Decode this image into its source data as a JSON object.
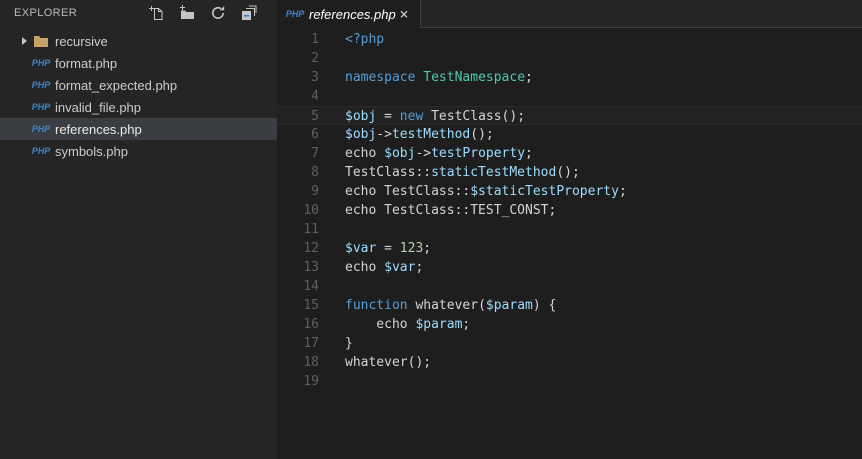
{
  "colors": {
    "editor_bg": "#1e1e1e",
    "sidebar_bg": "#252526",
    "selected_row_bg": "#3a3d41",
    "keyword": "#569cd6",
    "class_name": "#4ec9b0",
    "variable": "#9cdcfe",
    "number": "#b5cea8",
    "default_text": "#d4d4d4",
    "line_number": "#5f5f5f",
    "php_icon_blue": "#3e85c7",
    "folder_tan": "#c5a266",
    "icon_gray": "#c5c5c5"
  },
  "explorer": {
    "title": "EXPLORER",
    "actions": [
      {
        "name": "new-file-icon"
      },
      {
        "name": "new-folder-icon"
      },
      {
        "name": "refresh-icon"
      },
      {
        "name": "collapse-all-icon"
      }
    ],
    "php_badge_text": "PHP",
    "items": [
      {
        "kind": "folder",
        "label": "recursive",
        "expanded": false,
        "selected": false
      },
      {
        "kind": "php-file",
        "label": "format.php",
        "selected": false
      },
      {
        "kind": "php-file",
        "label": "format_expected.php",
        "selected": false
      },
      {
        "kind": "php-file",
        "label": "invalid_file.php",
        "selected": false
      },
      {
        "kind": "php-file",
        "label": "references.php",
        "selected": true
      },
      {
        "kind": "php-file",
        "label": "symbols.php",
        "selected": false
      }
    ]
  },
  "editor": {
    "tab": {
      "icon": "PHP",
      "label": "references.php",
      "close_label": "×"
    },
    "active_line": 5,
    "lines": [
      {
        "num": 1,
        "tokens": [
          [
            "kw",
            "<?php"
          ]
        ]
      },
      {
        "num": 2,
        "tokens": []
      },
      {
        "num": 3,
        "tokens": [
          [
            "kw",
            "namespace"
          ],
          [
            "def",
            " "
          ],
          [
            "cls",
            "TestNamespace"
          ],
          [
            "def",
            ";"
          ]
        ]
      },
      {
        "num": 4,
        "tokens": []
      },
      {
        "num": 5,
        "tokens": [
          [
            "var",
            "$obj"
          ],
          [
            "def",
            " = "
          ],
          [
            "kw",
            "new"
          ],
          [
            "def",
            " TestClass();"
          ]
        ]
      },
      {
        "num": 6,
        "tokens": [
          [
            "var",
            "$obj"
          ],
          [
            "def",
            "->"
          ],
          [
            "var",
            "testMethod"
          ],
          [
            "def",
            "();"
          ]
        ]
      },
      {
        "num": 7,
        "tokens": [
          [
            "def",
            "echo "
          ],
          [
            "var",
            "$obj"
          ],
          [
            "def",
            "->"
          ],
          [
            "var",
            "testProperty"
          ],
          [
            "def",
            ";"
          ]
        ]
      },
      {
        "num": 8,
        "tokens": [
          [
            "def",
            "TestClass::"
          ],
          [
            "var",
            "staticTestMethod"
          ],
          [
            "def",
            "();"
          ]
        ]
      },
      {
        "num": 9,
        "tokens": [
          [
            "def",
            "echo TestClass::"
          ],
          [
            "var",
            "$staticTestProperty"
          ],
          [
            "def",
            ";"
          ]
        ]
      },
      {
        "num": 10,
        "tokens": [
          [
            "def",
            "echo TestClass::TEST_CONST;"
          ]
        ]
      },
      {
        "num": 11,
        "tokens": []
      },
      {
        "num": 12,
        "tokens": [
          [
            "var",
            "$var"
          ],
          [
            "def",
            " = "
          ],
          [
            "num",
            "123"
          ],
          [
            "def",
            ";"
          ]
        ]
      },
      {
        "num": 13,
        "tokens": [
          [
            "def",
            "echo "
          ],
          [
            "var",
            "$var"
          ],
          [
            "def",
            ";"
          ]
        ]
      },
      {
        "num": 14,
        "tokens": []
      },
      {
        "num": 15,
        "tokens": [
          [
            "kw",
            "function"
          ],
          [
            "def",
            " whatever("
          ],
          [
            "var",
            "$param"
          ],
          [
            "def",
            ") {"
          ]
        ]
      },
      {
        "num": 16,
        "tokens": [
          [
            "def",
            "    echo "
          ],
          [
            "var",
            "$param"
          ],
          [
            "def",
            ";"
          ]
        ]
      },
      {
        "num": 17,
        "tokens": [
          [
            "def",
            "}"
          ]
        ]
      },
      {
        "num": 18,
        "tokens": [
          [
            "def",
            "whatever();"
          ]
        ]
      },
      {
        "num": 19,
        "tokens": []
      }
    ]
  }
}
